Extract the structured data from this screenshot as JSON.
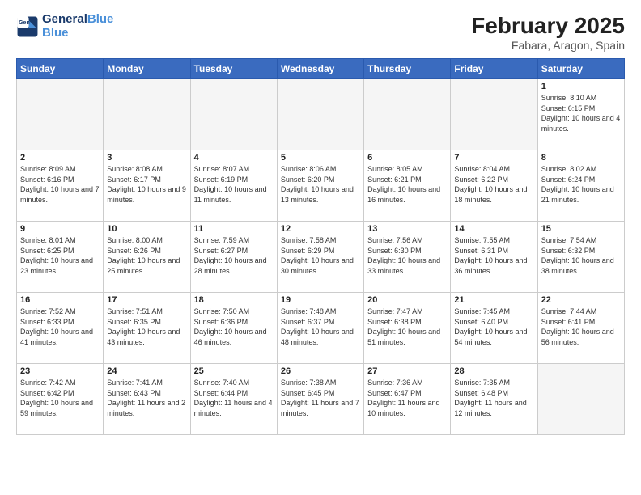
{
  "header": {
    "logo": {
      "line1": "General",
      "line2": "Blue"
    },
    "title": "February 2025",
    "location": "Fabara, Aragon, Spain"
  },
  "weekdays": [
    "Sunday",
    "Monday",
    "Tuesday",
    "Wednesday",
    "Thursday",
    "Friday",
    "Saturday"
  ],
  "weeks": [
    [
      {
        "day": "",
        "info": ""
      },
      {
        "day": "",
        "info": ""
      },
      {
        "day": "",
        "info": ""
      },
      {
        "day": "",
        "info": ""
      },
      {
        "day": "",
        "info": ""
      },
      {
        "day": "",
        "info": ""
      },
      {
        "day": "1",
        "info": "Sunrise: 8:10 AM\nSunset: 6:15 PM\nDaylight: 10 hours\nand 4 minutes."
      }
    ],
    [
      {
        "day": "2",
        "info": "Sunrise: 8:09 AM\nSunset: 6:16 PM\nDaylight: 10 hours\nand 7 minutes."
      },
      {
        "day": "3",
        "info": "Sunrise: 8:08 AM\nSunset: 6:17 PM\nDaylight: 10 hours\nand 9 minutes."
      },
      {
        "day": "4",
        "info": "Sunrise: 8:07 AM\nSunset: 6:19 PM\nDaylight: 10 hours\nand 11 minutes."
      },
      {
        "day": "5",
        "info": "Sunrise: 8:06 AM\nSunset: 6:20 PM\nDaylight: 10 hours\nand 13 minutes."
      },
      {
        "day": "6",
        "info": "Sunrise: 8:05 AM\nSunset: 6:21 PM\nDaylight: 10 hours\nand 16 minutes."
      },
      {
        "day": "7",
        "info": "Sunrise: 8:04 AM\nSunset: 6:22 PM\nDaylight: 10 hours\nand 18 minutes."
      },
      {
        "day": "8",
        "info": "Sunrise: 8:02 AM\nSunset: 6:24 PM\nDaylight: 10 hours\nand 21 minutes."
      }
    ],
    [
      {
        "day": "9",
        "info": "Sunrise: 8:01 AM\nSunset: 6:25 PM\nDaylight: 10 hours\nand 23 minutes."
      },
      {
        "day": "10",
        "info": "Sunrise: 8:00 AM\nSunset: 6:26 PM\nDaylight: 10 hours\nand 25 minutes."
      },
      {
        "day": "11",
        "info": "Sunrise: 7:59 AM\nSunset: 6:27 PM\nDaylight: 10 hours\nand 28 minutes."
      },
      {
        "day": "12",
        "info": "Sunrise: 7:58 AM\nSunset: 6:29 PM\nDaylight: 10 hours\nand 30 minutes."
      },
      {
        "day": "13",
        "info": "Sunrise: 7:56 AM\nSunset: 6:30 PM\nDaylight: 10 hours\nand 33 minutes."
      },
      {
        "day": "14",
        "info": "Sunrise: 7:55 AM\nSunset: 6:31 PM\nDaylight: 10 hours\nand 36 minutes."
      },
      {
        "day": "15",
        "info": "Sunrise: 7:54 AM\nSunset: 6:32 PM\nDaylight: 10 hours\nand 38 minutes."
      }
    ],
    [
      {
        "day": "16",
        "info": "Sunrise: 7:52 AM\nSunset: 6:33 PM\nDaylight: 10 hours\nand 41 minutes."
      },
      {
        "day": "17",
        "info": "Sunrise: 7:51 AM\nSunset: 6:35 PM\nDaylight: 10 hours\nand 43 minutes."
      },
      {
        "day": "18",
        "info": "Sunrise: 7:50 AM\nSunset: 6:36 PM\nDaylight: 10 hours\nand 46 minutes."
      },
      {
        "day": "19",
        "info": "Sunrise: 7:48 AM\nSunset: 6:37 PM\nDaylight: 10 hours\nand 48 minutes."
      },
      {
        "day": "20",
        "info": "Sunrise: 7:47 AM\nSunset: 6:38 PM\nDaylight: 10 hours\nand 51 minutes."
      },
      {
        "day": "21",
        "info": "Sunrise: 7:45 AM\nSunset: 6:40 PM\nDaylight: 10 hours\nand 54 minutes."
      },
      {
        "day": "22",
        "info": "Sunrise: 7:44 AM\nSunset: 6:41 PM\nDaylight: 10 hours\nand 56 minutes."
      }
    ],
    [
      {
        "day": "23",
        "info": "Sunrise: 7:42 AM\nSunset: 6:42 PM\nDaylight: 10 hours\nand 59 minutes."
      },
      {
        "day": "24",
        "info": "Sunrise: 7:41 AM\nSunset: 6:43 PM\nDaylight: 11 hours\nand 2 minutes."
      },
      {
        "day": "25",
        "info": "Sunrise: 7:40 AM\nSunset: 6:44 PM\nDaylight: 11 hours\nand 4 minutes."
      },
      {
        "day": "26",
        "info": "Sunrise: 7:38 AM\nSunset: 6:45 PM\nDaylight: 11 hours\nand 7 minutes."
      },
      {
        "day": "27",
        "info": "Sunrise: 7:36 AM\nSunset: 6:47 PM\nDaylight: 11 hours\nand 10 minutes."
      },
      {
        "day": "28",
        "info": "Sunrise: 7:35 AM\nSunset: 6:48 PM\nDaylight: 11 hours\nand 12 minutes."
      },
      {
        "day": "",
        "info": ""
      }
    ]
  ]
}
